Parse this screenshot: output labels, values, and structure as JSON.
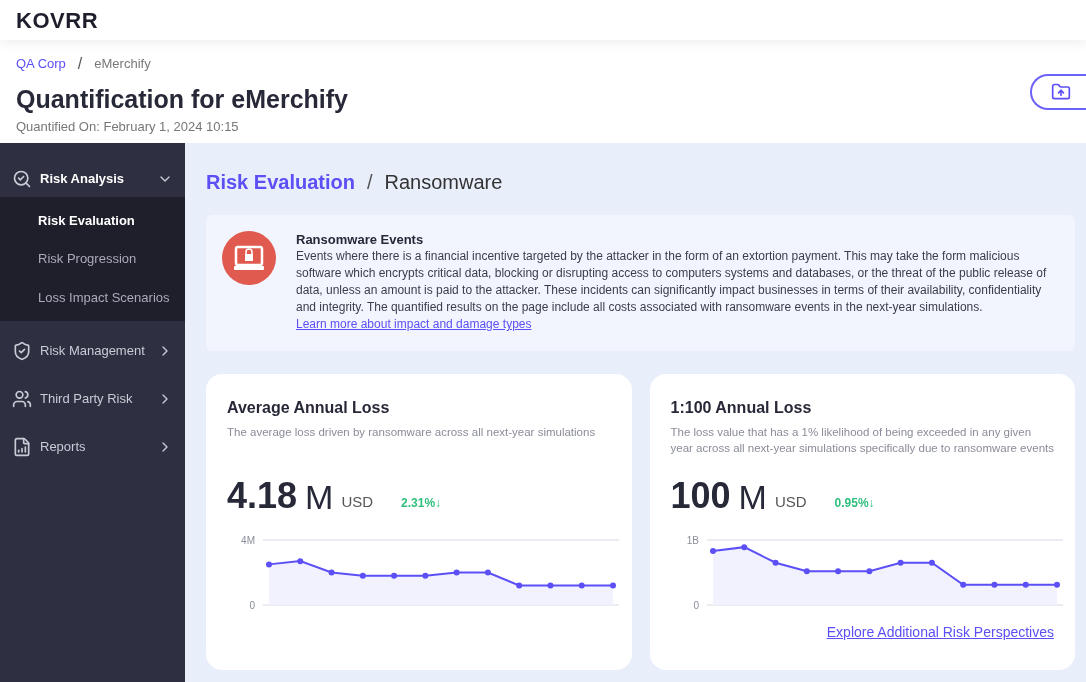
{
  "logo": "KOVRR",
  "breadcrumb": [
    {
      "label": "QA Corp",
      "kind": "link"
    },
    {
      "label": "/",
      "kind": "separator"
    },
    {
      "label": "eMerchify",
      "kind": "current"
    }
  ],
  "page": {
    "title": "Quantification for eMerchify",
    "subtitle": "Quantified On: February 1, 2024 10:15"
  },
  "sidebar": {
    "items": [
      {
        "label": "Risk Analysis",
        "expanded": true,
        "children": [
          {
            "label": "Risk Evaluation",
            "selected": true
          },
          {
            "label": "Risk Progression",
            "selected": false
          },
          {
            "label": "Loss Impact Scenarios",
            "selected": false
          }
        ]
      },
      {
        "label": "Risk Management",
        "expanded": false
      },
      {
        "label": "Third Party Risk",
        "expanded": false
      },
      {
        "label": "Reports",
        "expanded": false
      }
    ]
  },
  "content": {
    "breadcrumb": [
      "Risk Evaluation",
      "/",
      "Ransomware"
    ],
    "info": {
      "title": "Ransomware Events",
      "text": "Events where there is a financial incentive targeted by the attacker in the form of an extortion payment. This may take the form malicious software which encrypts critical data, blocking or disrupting access to computers systems and databases, or the threat of the public release of data, unless an amount is paid to the attacker. These incidents can significantly impact businesses in terms of their availability, confidentiality and integrity. The quantified results on the page include all costs associated with ransomware events in the next-year simulations.",
      "link": "Learn more about impact and damage types"
    },
    "cards": [
      {
        "title": "Average Annual Loss",
        "description": "The average loss driven by ransomware across all next-year simulations",
        "value": "4.18",
        "unit": "M",
        "currency": "USD",
        "change": "2.31%↓",
        "chart_data": {
          "type": "area",
          "series": [
            {
              "color": "#5b4ff5",
              "values": [
                2.5,
                2.7,
                2.0,
                1.8,
                1.8,
                1.8,
                2.0,
                2.0,
                1.2,
                1.2,
                1.2,
                1.2
              ]
            }
          ],
          "ylim": [
            0,
            4
          ],
          "yticks": [
            {
              "value": 0,
              "label": "0"
            },
            {
              "value": 4,
              "label": "4M"
            }
          ]
        }
      },
      {
        "title": "1:100 Annual Loss",
        "description": "The loss value that has a 1% likelihood of being exceeded in any given year across all next-year simulations specifically due to ransomware events",
        "value": "100",
        "unit": "M",
        "currency": "USD",
        "change": "0.95%↓",
        "chart_data": {
          "type": "area",
          "series": [
            {
              "color": "#5b4ff5",
              "values": [
                0.83,
                0.89,
                0.65,
                0.52,
                0.52,
                0.52,
                0.65,
                0.65,
                0.31,
                0.31,
                0.31,
                0.31
              ]
            }
          ],
          "ylim": [
            0,
            1
          ],
          "yticks": [
            {
              "value": 0,
              "label": "0"
            },
            {
              "value": 1,
              "label": "1B"
            }
          ]
        },
        "link": "Explore Additional Risk Perspectives"
      }
    ]
  }
}
